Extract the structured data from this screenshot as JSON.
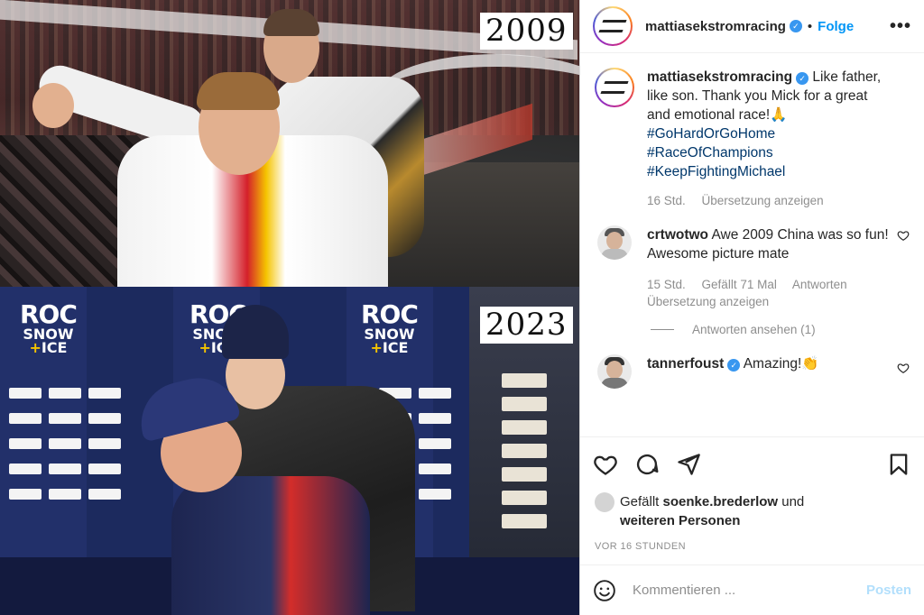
{
  "media": {
    "year_top": "2009",
    "year_bottom": "2023",
    "roc_word": "ROC",
    "roc_sub_1": "SNOW",
    "roc_sub_2": "ICE"
  },
  "header": {
    "username": "mattiasekstromracing",
    "separator": "•",
    "follow_label": "Folge",
    "more_label": "•••"
  },
  "caption": {
    "username": "mattiasekstromracing",
    "text": "Like father, like son. Thank you Mick for a great and emotional race!🙏",
    "tags": [
      "#GoHardOrGoHome",
      "#RaceOfChampions",
      "#KeepFightingMichael"
    ],
    "time": "16 Std.",
    "translate": "Übersetzung anzeigen"
  },
  "comments": [
    {
      "username": "crtwotwo",
      "text": "Awe 2009 China was so fun!",
      "text2": "Awesome picture mate",
      "time": "15 Std.",
      "likes": "Gefällt 71 Mal",
      "reply": "Antworten",
      "translate": "Übersetzung anzeigen",
      "view_replies": "Antworten ansehen (1)"
    },
    {
      "username": "tannerfoust",
      "text": "Amazing!👏"
    }
  ],
  "likes": {
    "prefix": "Gefällt",
    "user": "soenke.brederlow",
    "middle": "und",
    "others": "weiteren Personen"
  },
  "date": "VOR 16 STUNDEN",
  "add_comment": {
    "placeholder": "Kommentieren ...",
    "post_label": "Posten"
  },
  "colors": {
    "accent": "#0095f6",
    "verified": "#3897f0",
    "hashtag": "#00376b",
    "muted": "#8e8e8e"
  }
}
